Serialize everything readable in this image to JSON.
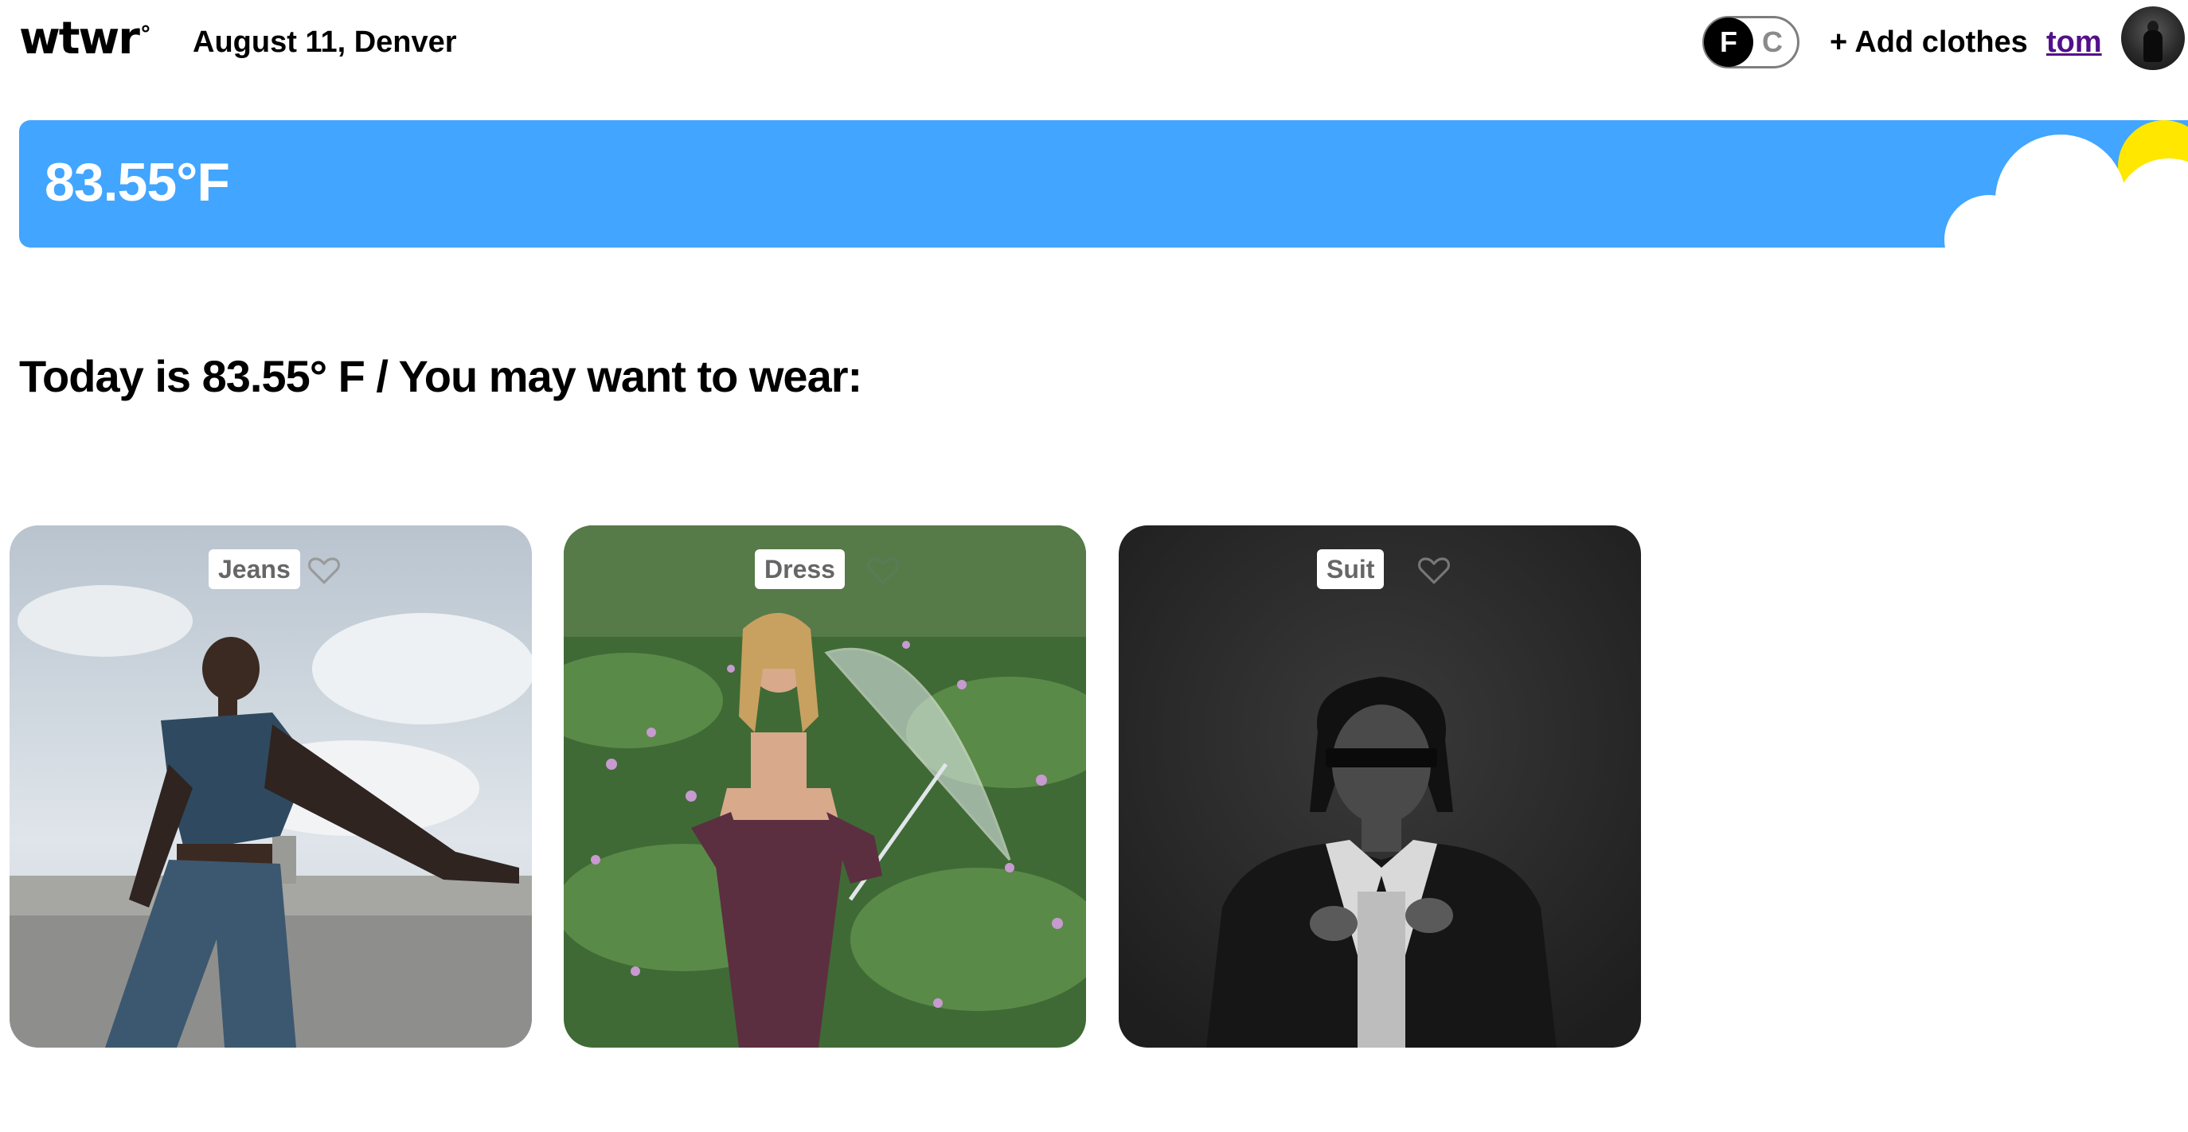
{
  "header": {
    "logo": "wtwr",
    "logo_degree": "°",
    "date_location": "August 11, Denver",
    "unit_toggle": {
      "f_label": "F",
      "c_label": "C",
      "selected": "F"
    },
    "add_clothes_label": "+ Add clothes",
    "username": "tom"
  },
  "weather": {
    "temperature": "83.55°F",
    "condition_icons": [
      "sun-icon",
      "cloud-icon"
    ],
    "background_color": "#42a5ff"
  },
  "main": {
    "heading": "Today is 83.55° F / You may want to wear:"
  },
  "cards": [
    {
      "name": "Jeans",
      "liked": false,
      "like_icon": "heart-outline-icon"
    },
    {
      "name": "Dress",
      "liked": false,
      "like_icon": "heart-outline-icon"
    },
    {
      "name": "Suit",
      "liked": false,
      "like_icon": "heart-outline-icon"
    }
  ],
  "colors": {
    "accent_blue": "#42a5ff",
    "sun_yellow": "#ffe700",
    "username_purple": "#52108a"
  }
}
